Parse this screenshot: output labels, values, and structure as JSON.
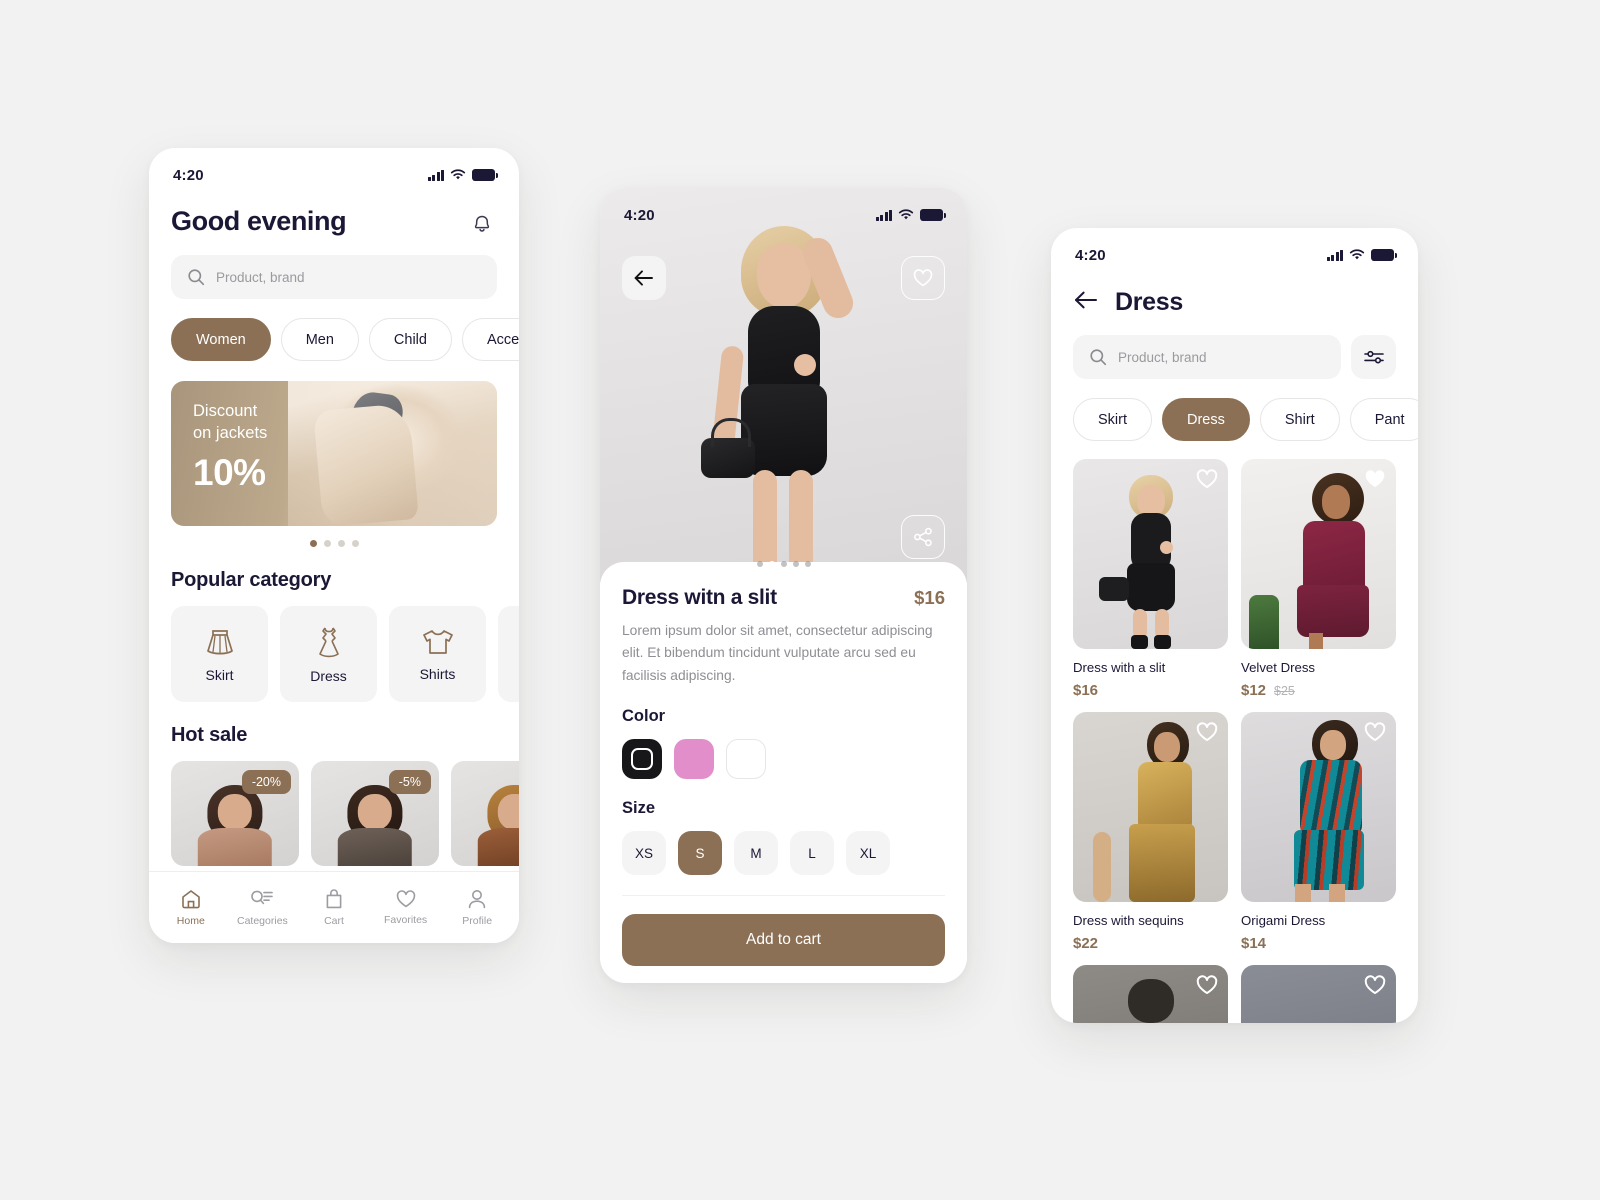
{
  "theme": {
    "accent": "#8b7055",
    "text": "#1b1836",
    "muted": "#8e8e94",
    "surface": "#f4f4f4"
  },
  "phone1": {
    "status": {
      "time": "4:20"
    },
    "greeting": "Good evening",
    "bell_icon": "bell-icon",
    "search": {
      "placeholder": "Product, brand",
      "icon": "search-icon"
    },
    "category_chips": [
      {
        "label": "Women",
        "active": true
      },
      {
        "label": "Men",
        "active": false
      },
      {
        "label": "Child",
        "active": false
      },
      {
        "label": "Accessories",
        "active": false
      }
    ],
    "banner": {
      "line1": "Discount",
      "line2": "on jackets",
      "percent": "10%",
      "dots": 4,
      "active_dot": 0
    },
    "popular_title": "Popular category",
    "categories": [
      {
        "label": "Skirt",
        "icon": "skirt-icon"
      },
      {
        "label": "Dress",
        "icon": "dress-icon"
      },
      {
        "label": "Shirts",
        "icon": "shirt-icon"
      },
      {
        "label": "",
        "icon": "pants-icon"
      }
    ],
    "hot_title": "Hot sale",
    "hot_items": [
      {
        "badge": "-20%"
      },
      {
        "badge": "-5%"
      },
      {
        "badge": ""
      }
    ],
    "tabs": [
      {
        "label": "Home",
        "icon": "home-icon",
        "active": true
      },
      {
        "label": "Categories",
        "icon": "categories-icon",
        "active": false
      },
      {
        "label": "Cart",
        "icon": "cart-icon",
        "active": false
      },
      {
        "label": "Favorites",
        "icon": "heart-icon",
        "active": false
      },
      {
        "label": "Profile",
        "icon": "person-icon",
        "active": false
      }
    ]
  },
  "phone2": {
    "status": {
      "time": "4:20"
    },
    "back_icon": "arrow-left-icon",
    "favorite_icon": "heart-outline-icon",
    "share_icon": "share-icon",
    "gallery": {
      "dots": 5,
      "active_dot": 1
    },
    "product": {
      "title": "Dress witn a slit",
      "price": "$16",
      "description": "Lorem ipsum dolor sit amet, consectetur adipiscing elit. Et bibendum tincidunt vulputate arcu sed eu facilisis adipiscing."
    },
    "color_label": "Color",
    "colors": [
      {
        "name": "black",
        "hex": "#17171a",
        "selected": true
      },
      {
        "name": "pink",
        "hex": "#e28ecb",
        "selected": false
      },
      {
        "name": "white",
        "hex": "#ffffff",
        "selected": false
      }
    ],
    "size_label": "Size",
    "sizes": [
      {
        "label": "XS",
        "active": false
      },
      {
        "label": "S",
        "active": true
      },
      {
        "label": "M",
        "active": false
      },
      {
        "label": "L",
        "active": false
      },
      {
        "label": "XL",
        "active": false
      }
    ],
    "add_to_cart": "Add to cart"
  },
  "phone3": {
    "status": {
      "time": "4:20"
    },
    "back_icon": "arrow-left-icon",
    "title": "Dress",
    "search": {
      "placeholder": "Product, brand",
      "icon": "search-icon"
    },
    "filter_icon": "filter-icon",
    "chips": [
      {
        "label": "Skirt",
        "active": false
      },
      {
        "label": "Dress",
        "active": true
      },
      {
        "label": "Shirt",
        "active": false
      },
      {
        "label": "Pant",
        "active": false
      }
    ],
    "products": [
      {
        "name": "Dress with a slit",
        "price": "$16",
        "old_price": "",
        "favorited": false,
        "thumb": "grey"
      },
      {
        "name": "Velvet Dress",
        "price": "$12",
        "old_price": "$25",
        "favorited": true,
        "thumb": "white"
      },
      {
        "name": "Dress with sequins",
        "price": "$22",
        "old_price": "",
        "favorited": false,
        "thumb": "warm"
      },
      {
        "name": "Origami Dress",
        "price": "$14",
        "old_price": "",
        "favorited": false,
        "thumb": "cool"
      },
      {
        "name": "",
        "price": "",
        "old_price": "",
        "favorited": false,
        "thumb": "dark"
      },
      {
        "name": "",
        "price": "",
        "old_price": "",
        "favorited": false,
        "thumb": "slate"
      }
    ]
  }
}
